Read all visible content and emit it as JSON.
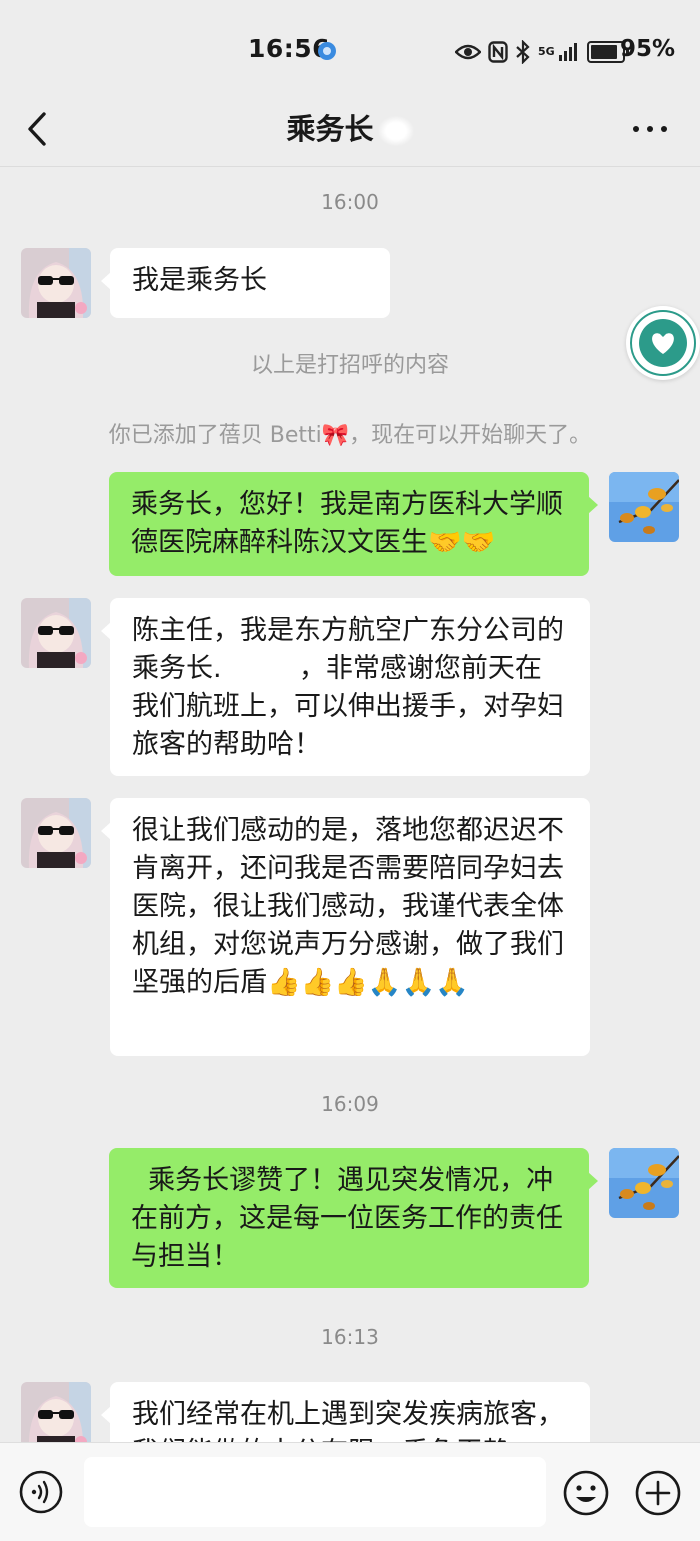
{
  "status_bar": {
    "time": "16:56",
    "network": "5G",
    "battery": "95%"
  },
  "header": {
    "title": "乘务长"
  },
  "messages": {
    "ts1": "16:00",
    "m1": "我是乘务长",
    "sys1": "以上是打招呼的内容",
    "sys2": "你已添加了蓓贝 Betti🎀，现在可以开始聊天了。",
    "m2": "乘务长，您好！我是南方医科大学顺德医院麻醉科陈汉文医生🤝🤝",
    "m3": "陈主任，我是东方航空广东分公司的乘务长.         ，非常感谢您前天在我们航班上，可以伸出援手，对孕妇旅客的帮助哈！",
    "m4": "很让我们感动的是，落地您都迟迟不肯离开，还问我是否需要陪同孕妇去医院，很让我们感动，我谨代表全体机组，对您说声万分感谢，做了我们坚强的后盾👍👍👍🙏🙏🙏",
    "ts2": "16:09",
    "m5": "  乘务长谬赞了！遇见突发情况，冲在前方，这是每一位医务工作的责任与担当！",
    "ts3": "16:13",
    "m6": "我们经常在机上遇到突发疾病旅客，我们能做的十分有限，垂危平静"
  }
}
